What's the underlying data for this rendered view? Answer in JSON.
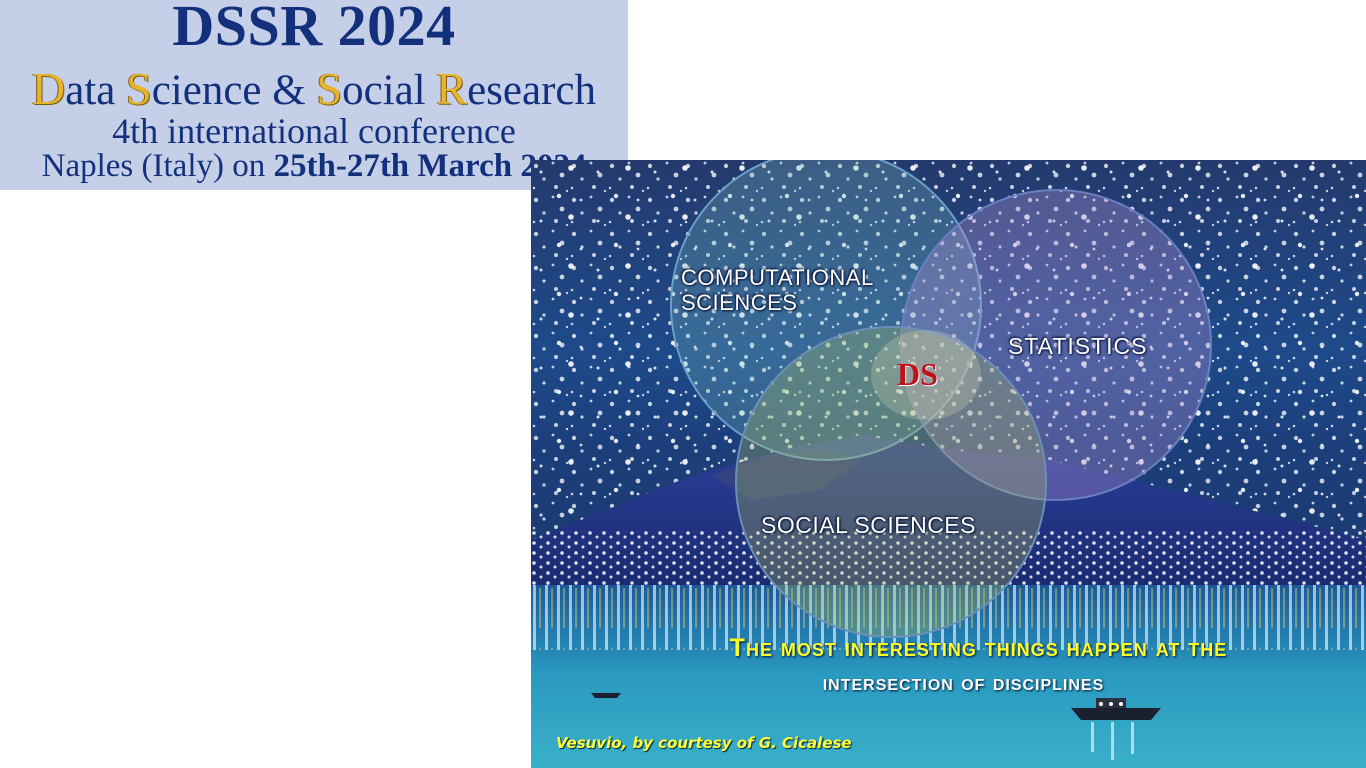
{
  "header": {
    "title": "DSSR 2024",
    "subtitle": {
      "word1_initial": "D",
      "word1_rest": "ata ",
      "word2_initial": "S",
      "word2_rest": "cience & ",
      "word3_initial": "S",
      "word3_rest": "ocial ",
      "word4_initial": "R",
      "word4_rest": "esearch"
    },
    "edition": "4th international conference",
    "location_prefix": "Naples (Italy) on ",
    "dates": "25th-27th March 2024"
  },
  "venn": {
    "computational_line1": "COMPUTATIONAL",
    "computational_line2": "SCIENCES",
    "statistics": "STATISTICS",
    "social": "SOCIAL SCIENCES",
    "center": "DS"
  },
  "motto": {
    "line1": "The most interesting things happen at the",
    "line2": "intersection of disciplines"
  },
  "credit": "Vesuvio,  by courtesy of G. Cicalese",
  "colors": {
    "header_bg": "#c5d0e8",
    "header_text": "#13307c",
    "initial_gold": "#e8b52a",
    "center_red": "#c0121a",
    "motto_yellow": "#ffff2a"
  }
}
